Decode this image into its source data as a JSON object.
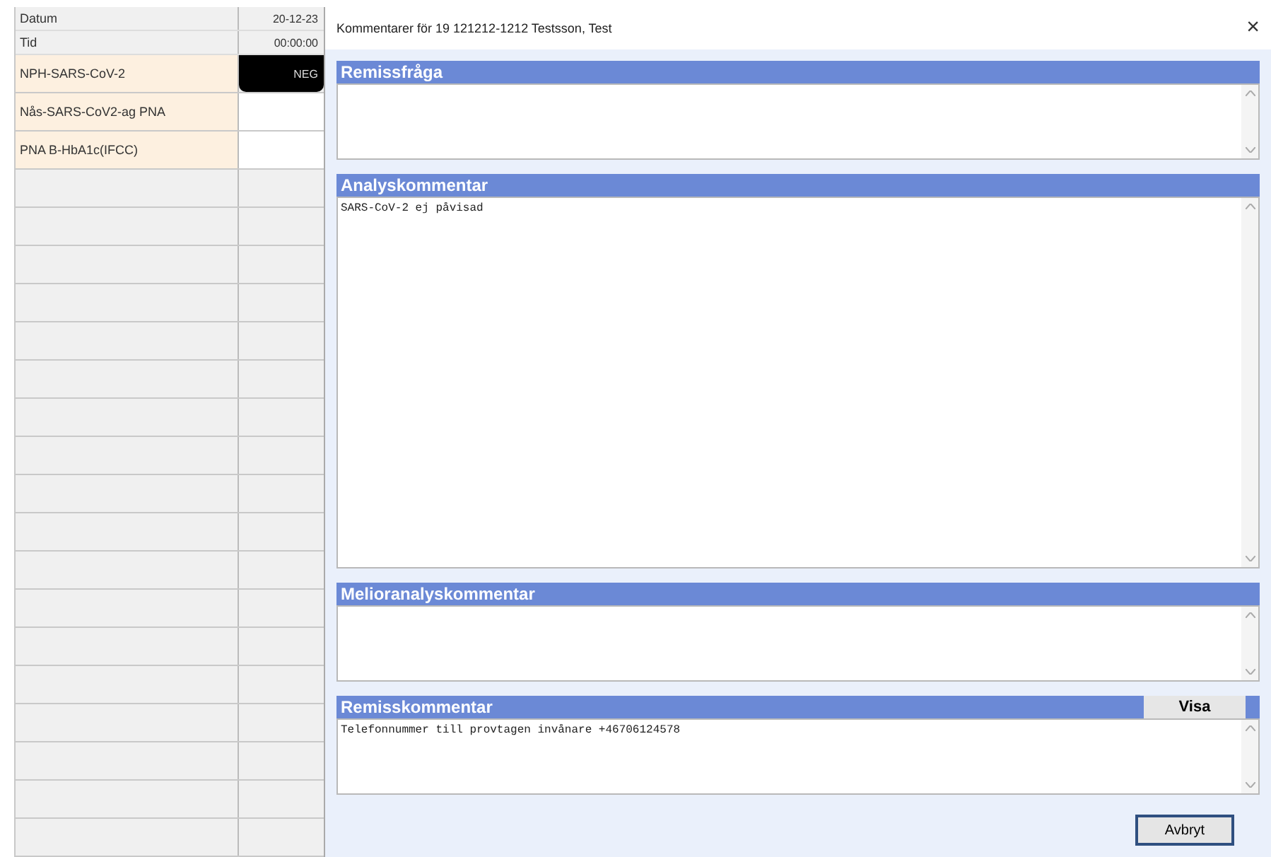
{
  "table": {
    "header_rows": [
      {
        "label": "Datum",
        "value": "20-12-23"
      },
      {
        "label": "Tid",
        "value": "00:00:00"
      }
    ],
    "rows": [
      {
        "name": "NPH-SARS-CoV-2",
        "result": "NEG",
        "highlighted": true
      },
      {
        "name": "Nås-SARS-CoV2-ag PNA",
        "highlighted": false
      },
      {
        "name": "PNA B-HbA1c(IFCC)",
        "highlighted": false
      }
    ]
  },
  "dialog": {
    "title": "Kommentarer för 19 121212-1212 Testsson, Test",
    "close": "×",
    "sections": [
      {
        "title": "Remissfråga",
        "kind": "compact"
      },
      {
        "title": "Analyskommentar",
        "text": "SARS-CoV-2 ej påvisad",
        "kind": "expanding"
      },
      {
        "title": "Melioranalyskommentar",
        "kind": "compact"
      },
      {
        "title": "Remisskommentar",
        "text": "Telefonnummer till provtagen invånare +46706124578",
        "button": "Visa",
        "kind": "compact"
      }
    ],
    "buttons": [
      "Avbryt"
    ]
  }
}
